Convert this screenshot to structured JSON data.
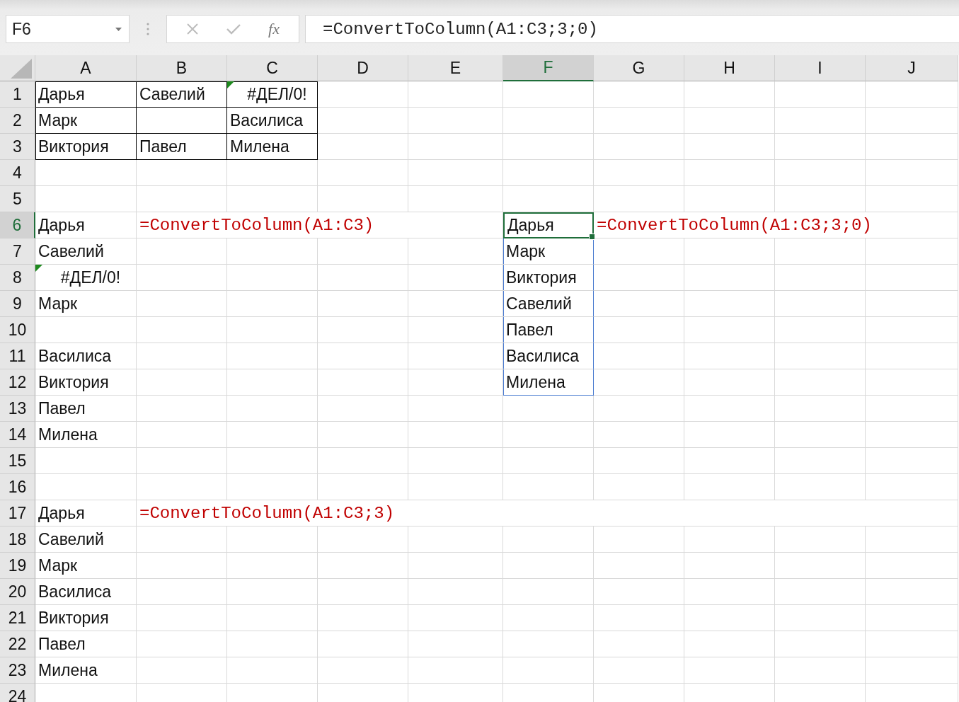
{
  "formula_bar": {
    "name_box": "F6",
    "function_button": "fx",
    "formula": "=ConvertToColumn(A1:C3;3;0)"
  },
  "columns": [
    {
      "label": "A",
      "selected": false
    },
    {
      "label": "B",
      "selected": false
    },
    {
      "label": "C",
      "selected": false
    },
    {
      "label": "D",
      "selected": false
    },
    {
      "label": "E",
      "selected": false
    },
    {
      "label": "F",
      "selected": true
    },
    {
      "label": "G",
      "selected": false
    },
    {
      "label": "H",
      "selected": false
    },
    {
      "label": "I",
      "selected": false
    },
    {
      "label": "J",
      "selected": false
    }
  ],
  "rows": [
    {
      "label": "1",
      "selected": false,
      "cells": [
        {
          "kind": "text",
          "text": "Дарья",
          "bordered": true
        },
        {
          "kind": "text",
          "text": "Савелий",
          "bordered": true
        },
        {
          "kind": "error",
          "text": "#ДЕЛ/0!",
          "bordered": true
        }
      ]
    },
    {
      "label": "2",
      "selected": false,
      "cells": [
        {
          "kind": "text",
          "text": "Марк",
          "bordered": true
        },
        {
          "kind": "blank",
          "bordered": true
        },
        {
          "kind": "text",
          "text": "Василиса",
          "bordered": true
        }
      ]
    },
    {
      "label": "3",
      "selected": false,
      "cells": [
        {
          "kind": "text",
          "text": "Виктория",
          "bordered": true
        },
        {
          "kind": "text",
          "text": "Павел",
          "bordered": true
        },
        {
          "kind": "text",
          "text": "Милена",
          "bordered": true
        }
      ]
    },
    {
      "label": "4",
      "selected": false,
      "cells": []
    },
    {
      "label": "5",
      "selected": false,
      "cells": []
    },
    {
      "label": "6",
      "selected": true,
      "cells": [
        {
          "kind": "text",
          "text": "Дарья"
        },
        {
          "kind": "formula",
          "text": "=ConvertToColumn(A1:C3)"
        },
        {
          "kind": "blank"
        },
        {
          "kind": "blank"
        },
        {
          "kind": "blank"
        },
        {
          "kind": "text",
          "text": "Дарья",
          "active": true,
          "spill": true
        },
        {
          "kind": "formula",
          "text": "=ConvertToColumn(A1:C3;3;0)"
        }
      ]
    },
    {
      "label": "7",
      "selected": false,
      "cells": [
        {
          "kind": "text",
          "text": "Савелий"
        },
        {
          "kind": "blank"
        },
        {
          "kind": "blank"
        },
        {
          "kind": "blank"
        },
        {
          "kind": "blank"
        },
        {
          "kind": "text",
          "text": "Марк",
          "spill": true
        }
      ]
    },
    {
      "label": "8",
      "selected": false,
      "cells": [
        {
          "kind": "error",
          "text": "#ДЕЛ/0!"
        },
        {
          "kind": "blank"
        },
        {
          "kind": "blank"
        },
        {
          "kind": "blank"
        },
        {
          "kind": "blank"
        },
        {
          "kind": "text",
          "text": "Виктория",
          "spill": true
        }
      ]
    },
    {
      "label": "9",
      "selected": false,
      "cells": [
        {
          "kind": "text",
          "text": "Марк"
        },
        {
          "kind": "blank"
        },
        {
          "kind": "blank"
        },
        {
          "kind": "blank"
        },
        {
          "kind": "blank"
        },
        {
          "kind": "text",
          "text": "Савелий",
          "spill": true
        }
      ]
    },
    {
      "label": "10",
      "selected": false,
      "cells": [
        {
          "kind": "blank"
        },
        {
          "kind": "blank"
        },
        {
          "kind": "blank"
        },
        {
          "kind": "blank"
        },
        {
          "kind": "blank"
        },
        {
          "kind": "text",
          "text": "Павел",
          "spill": true
        }
      ]
    },
    {
      "label": "11",
      "selected": false,
      "cells": [
        {
          "kind": "text",
          "text": "Василиса"
        },
        {
          "kind": "blank"
        },
        {
          "kind": "blank"
        },
        {
          "kind": "blank"
        },
        {
          "kind": "blank"
        },
        {
          "kind": "text",
          "text": "Василиса",
          "spill": true
        }
      ]
    },
    {
      "label": "12",
      "selected": false,
      "cells": [
        {
          "kind": "text",
          "text": "Виктория"
        },
        {
          "kind": "blank"
        },
        {
          "kind": "blank"
        },
        {
          "kind": "blank"
        },
        {
          "kind": "blank"
        },
        {
          "kind": "text",
          "text": "Милена",
          "spill": true
        }
      ]
    },
    {
      "label": "13",
      "selected": false,
      "cells": [
        {
          "kind": "text",
          "text": "Павел"
        }
      ]
    },
    {
      "label": "14",
      "selected": false,
      "cells": [
        {
          "kind": "text",
          "text": "Милена"
        }
      ]
    },
    {
      "label": "15",
      "selected": false,
      "cells": []
    },
    {
      "label": "16",
      "selected": false,
      "cells": []
    },
    {
      "label": "17",
      "selected": false,
      "cells": [
        {
          "kind": "text",
          "text": "Дарья"
        },
        {
          "kind": "formula",
          "text": "=ConvertToColumn(A1:C3;3)"
        }
      ]
    },
    {
      "label": "18",
      "selected": false,
      "cells": [
        {
          "kind": "text",
          "text": "Савелий"
        }
      ]
    },
    {
      "label": "19",
      "selected": false,
      "cells": [
        {
          "kind": "text",
          "text": "Марк"
        }
      ]
    },
    {
      "label": "20",
      "selected": false,
      "cells": [
        {
          "kind": "text",
          "text": "Василиса"
        }
      ]
    },
    {
      "label": "21",
      "selected": false,
      "cells": [
        {
          "kind": "text",
          "text": "Виктория"
        }
      ]
    },
    {
      "label": "22",
      "selected": false,
      "cells": [
        {
          "kind": "text",
          "text": "Павел"
        }
      ]
    },
    {
      "label": "23",
      "selected": false,
      "cells": [
        {
          "kind": "text",
          "text": "Милена"
        }
      ]
    },
    {
      "label": "24",
      "selected": false,
      "cells": []
    }
  ]
}
